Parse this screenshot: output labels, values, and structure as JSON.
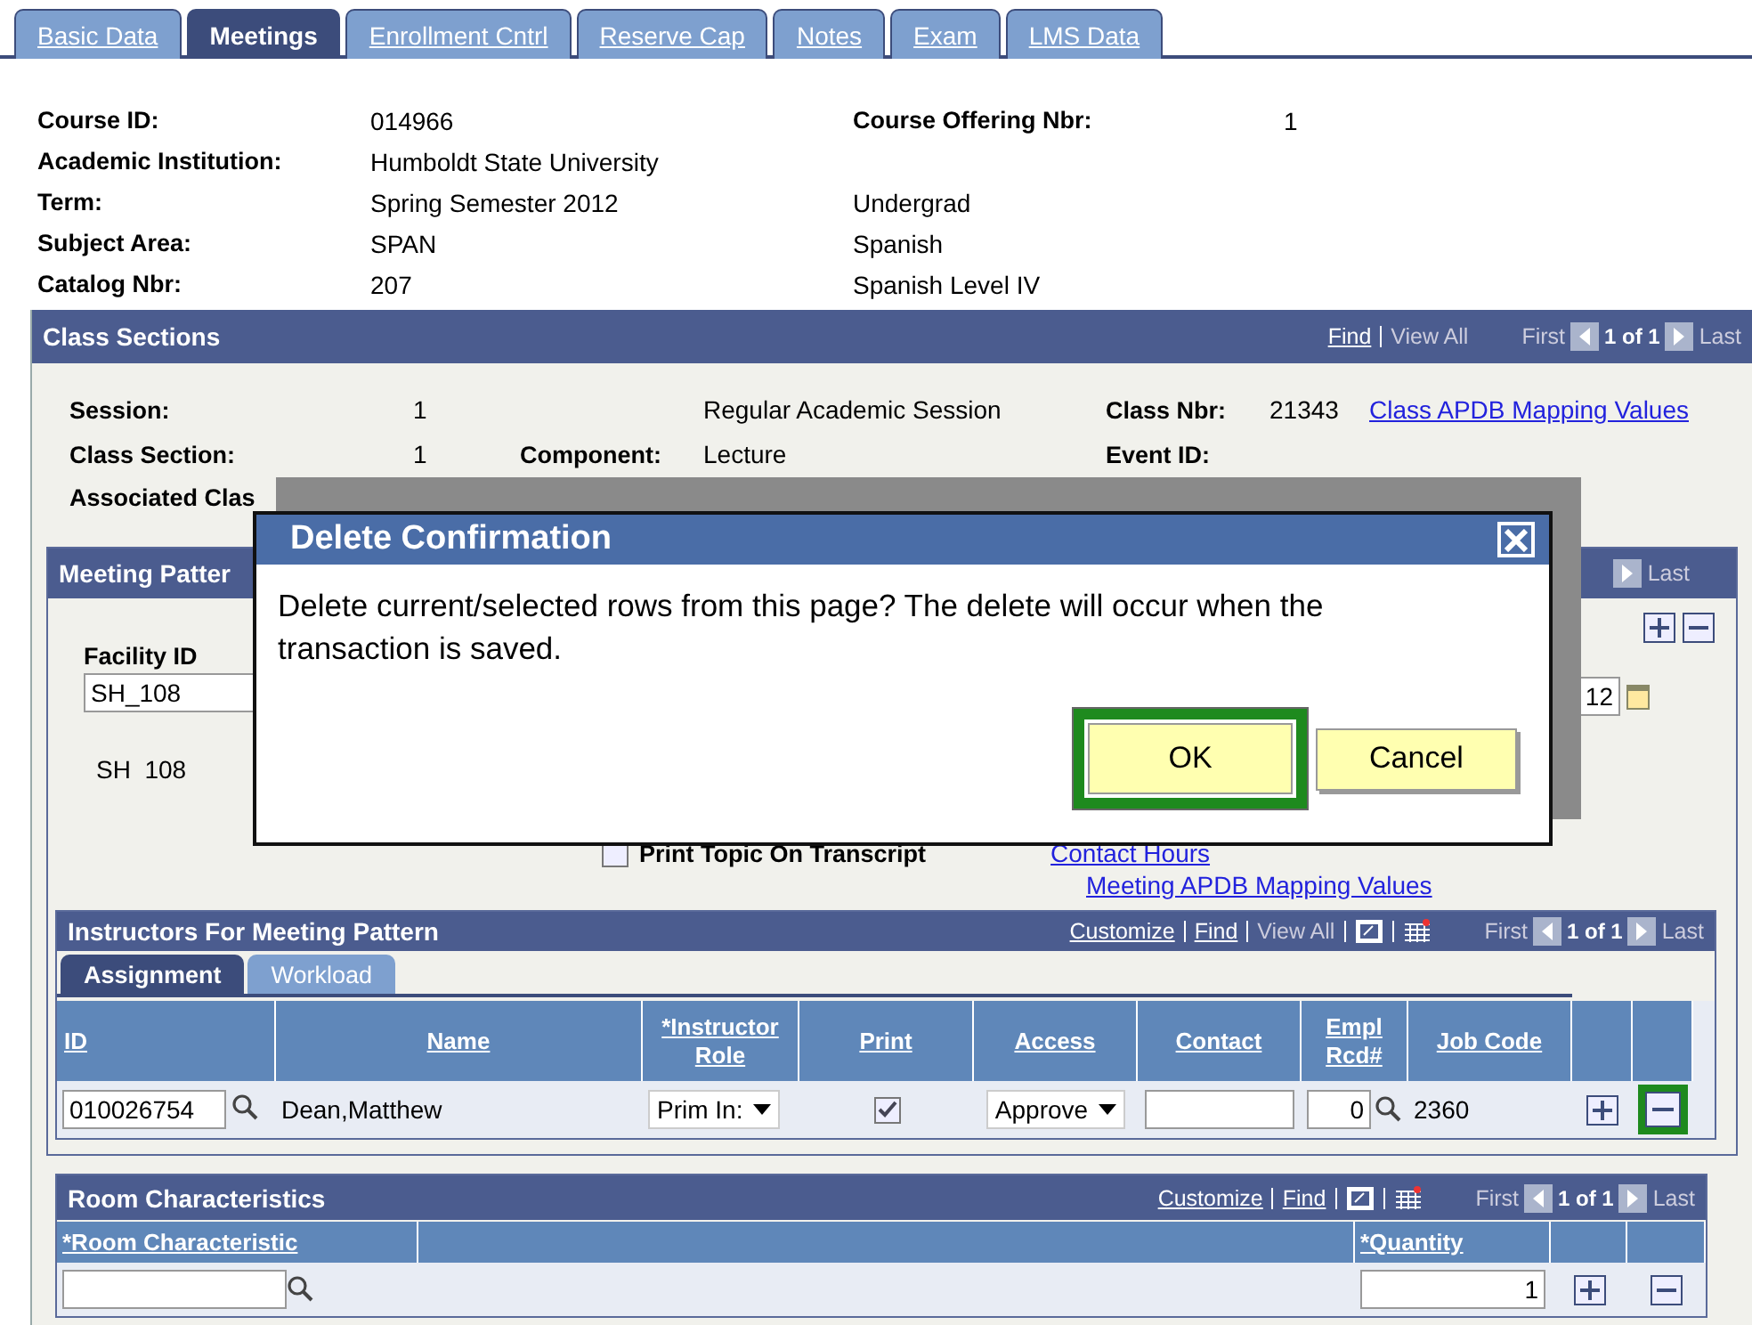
{
  "tabs": [
    {
      "label": "Basic Data",
      "selected": false
    },
    {
      "label": "Meetings",
      "selected": true
    },
    {
      "label": "Enrollment Cntrl",
      "selected": false
    },
    {
      "label": "Reserve Cap",
      "selected": false
    },
    {
      "label": "Notes",
      "selected": false
    },
    {
      "label": "Exam",
      "selected": false
    },
    {
      "label": "LMS Data",
      "selected": false
    }
  ],
  "header": [
    {
      "label": "Course ID:",
      "value": "014966",
      "label_2": "Course Offering Nbr:",
      "value_2": "1"
    },
    {
      "label": "Academic Institution:",
      "value": "Humboldt State University"
    },
    {
      "label": "Term:",
      "value": "Spring Semester 2012",
      "note": "Undergrad"
    },
    {
      "label": "Subject Area:",
      "value": "SPAN",
      "note": "Spanish"
    },
    {
      "label": "Catalog Nbr:",
      "value": "207",
      "note": "Spanish Level IV"
    }
  ],
  "class_sections": {
    "title": "Class Sections",
    "nav": {
      "find": "Find",
      "view_all": "View All",
      "first": "First",
      "count": "1 of 1",
      "last": "Last"
    },
    "session_label": "Session:",
    "session": "1",
    "session_desc": "Regular Academic Session",
    "class_nbr_label": "Class Nbr:",
    "class_nbr": "21343",
    "mapping_link": "Class APDB Mapping Values",
    "section_label": "Class Section:",
    "section": "1",
    "component_label": "Component:",
    "component": "Lecture",
    "event_label": "Event ID:",
    "associated_label": "Associated Clas"
  },
  "meeting_pattern": {
    "title": "Meeting Patter",
    "last": "Last",
    "facility_label": "Facility ID",
    "facility_value": "SH_108",
    "facility_desc": "SH  108",
    "date_value": "12",
    "print_topic": {
      "label": "Print Topic On Transcript",
      "checked": false
    },
    "links": [
      "Contact Hours",
      "Meeting APDB Mapping Values"
    ]
  },
  "instructors": {
    "title": "Instructors For Meeting Pattern",
    "nav": {
      "customize": "Customize",
      "find": "Find",
      "view_all": "View All",
      "first": "First",
      "count": "1 of 1",
      "last": "Last"
    },
    "sub_tabs": [
      {
        "label": "Assignment",
        "selected": true
      },
      {
        "label": "Workload",
        "selected": false
      }
    ],
    "columns": [
      "ID",
      "Name",
      "*Instructor Role",
      "Print",
      "Access",
      "Contact",
      "Empl Rcd#",
      "Job Code"
    ],
    "rows": [
      {
        "id": "010026754",
        "name": "Dean,Matthew",
        "role": "Prim In:",
        "print": true,
        "access": "Approve",
        "empl_rcd": "0",
        "job_code": "2360",
        "delete_highlighted": true
      }
    ]
  },
  "room_characteristics": {
    "title": "Room Characteristics",
    "nav": {
      "customize": "Customize",
      "find": "Find",
      "first": "First",
      "count": "1 of 1",
      "last": "Last"
    },
    "columns": [
      "*Room Characteristic",
      "*Quantity"
    ],
    "rows": [
      {
        "quantity": "1"
      }
    ]
  },
  "dialog": {
    "title": "Delete Confirmation",
    "message": "Delete current/selected rows from this page? The delete will occur when the transaction is saved.",
    "buttons": [
      {
        "label": "OK",
        "highlighted": true
      },
      {
        "label": "Cancel",
        "highlighted": false
      }
    ]
  }
}
